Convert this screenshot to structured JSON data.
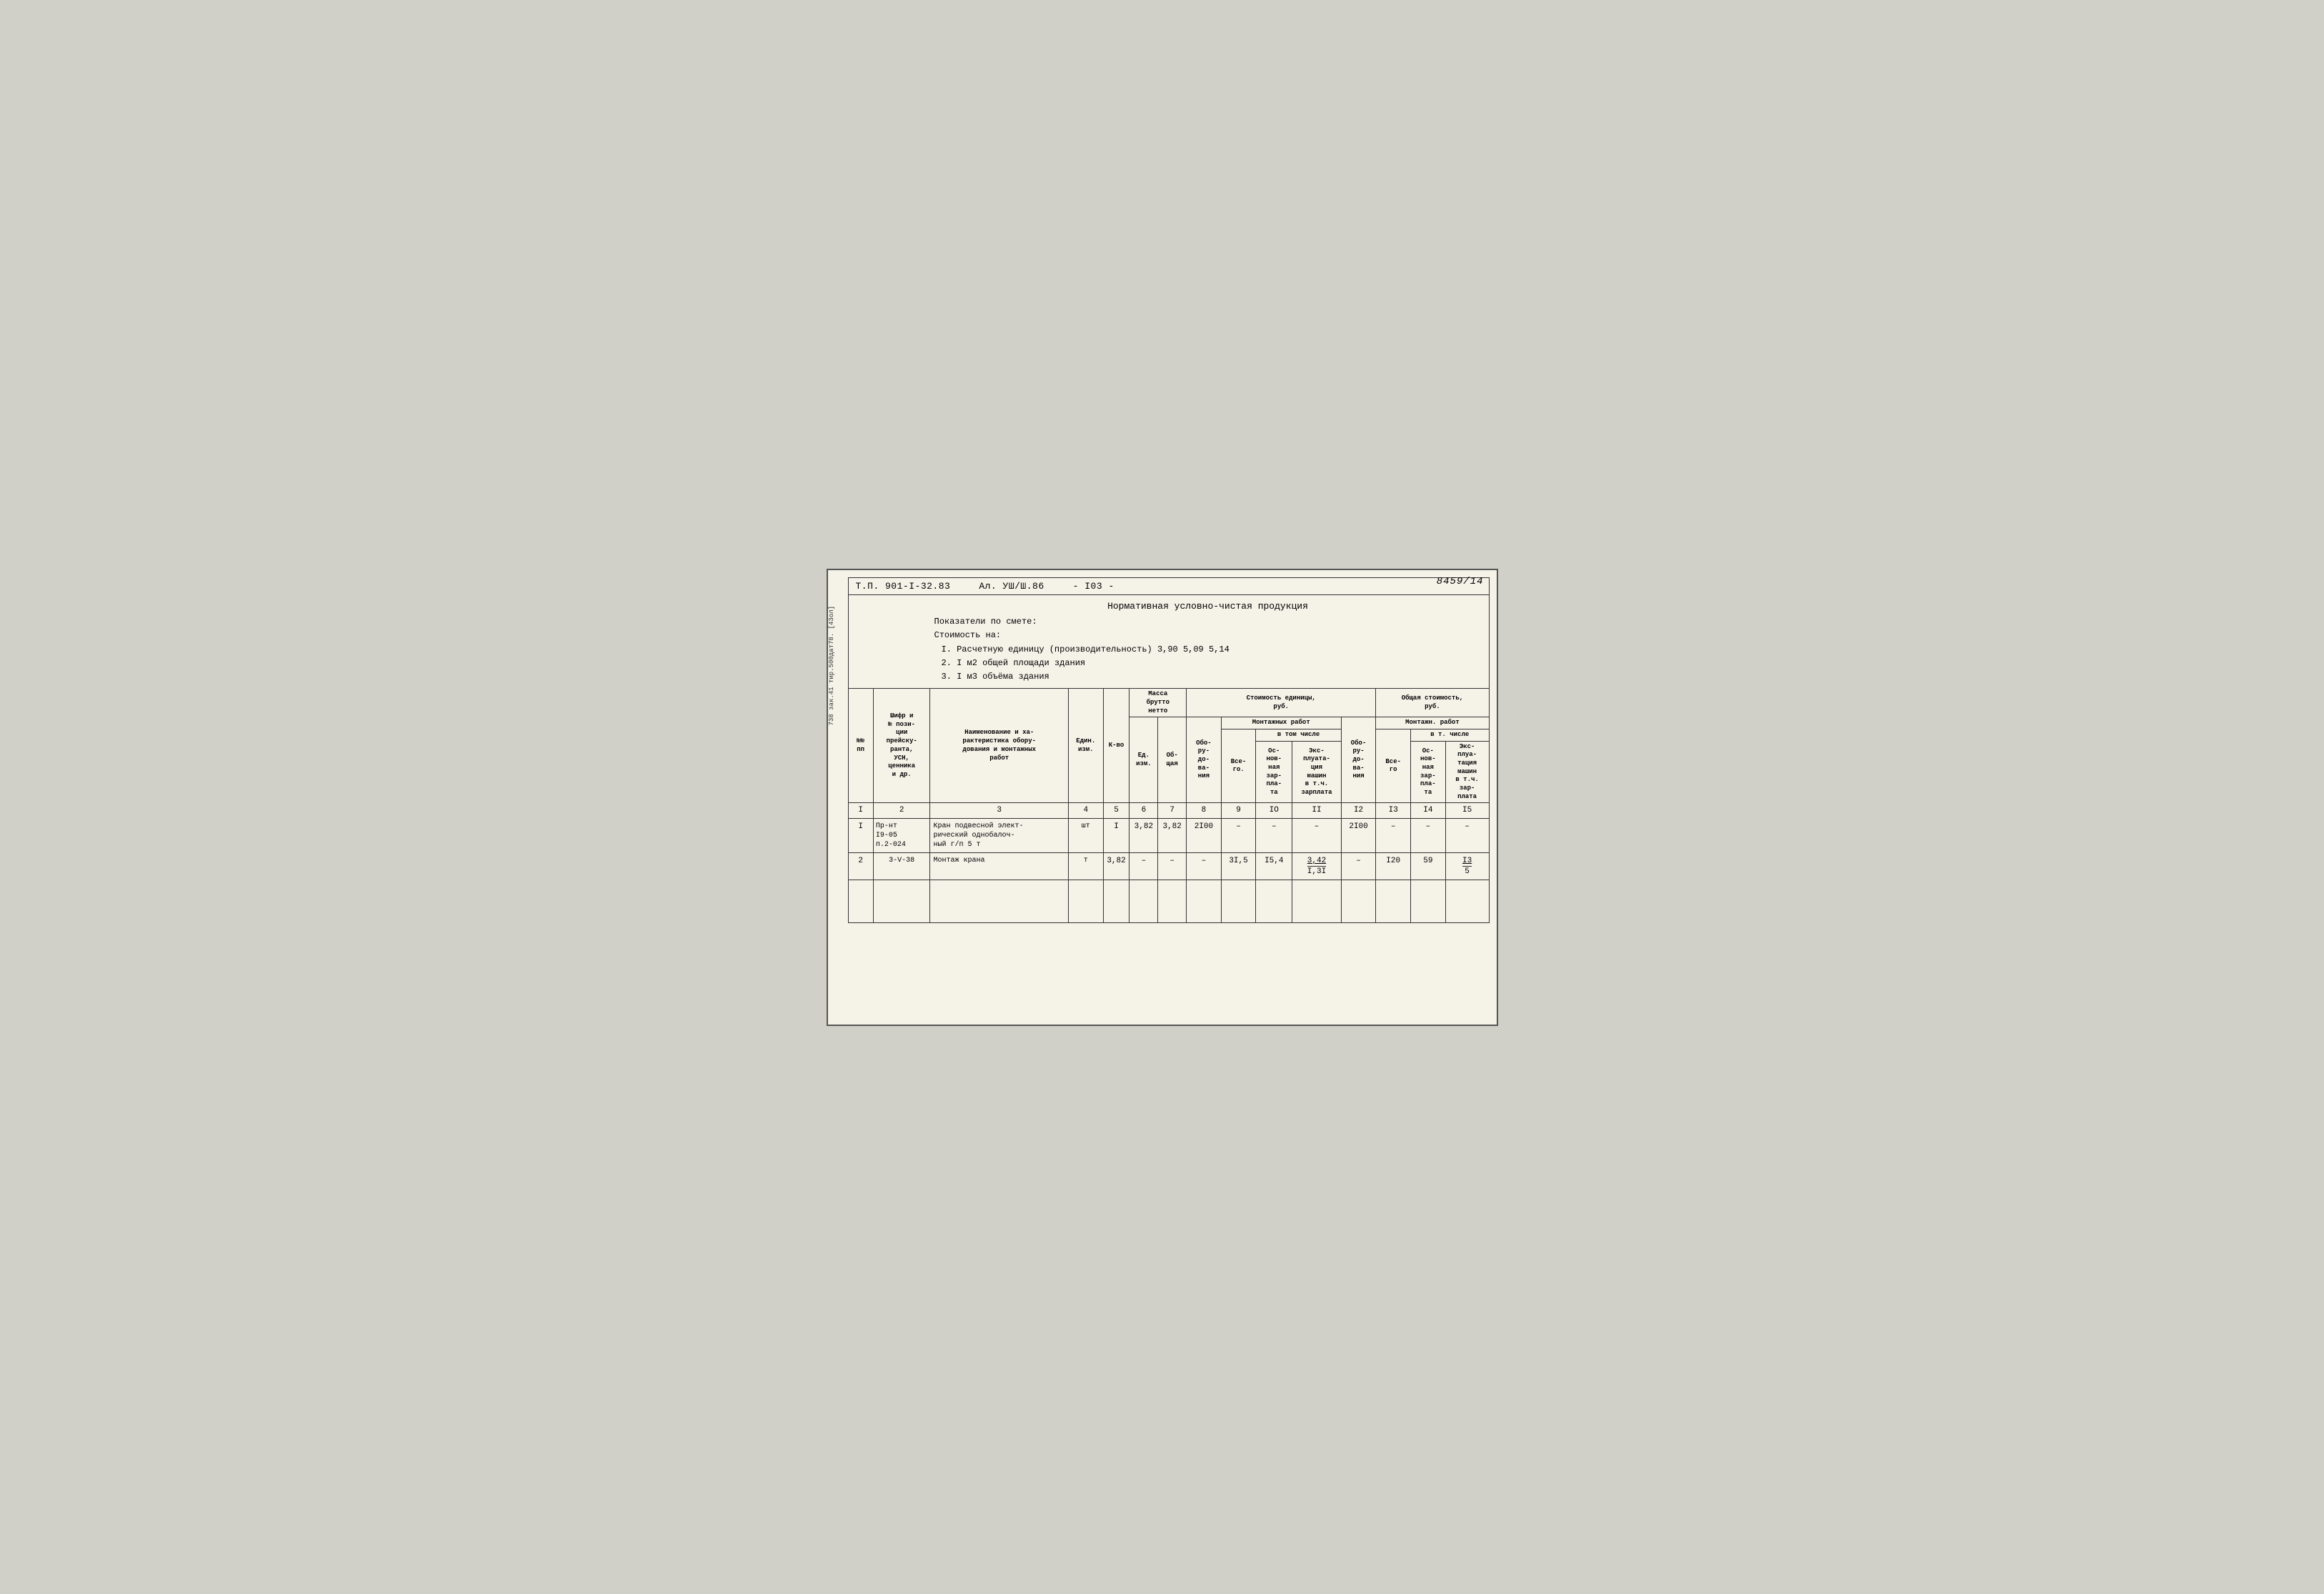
{
  "page": {
    "page_number": "8459/14",
    "side_text": "738 зак.41 тир.500дат78. [43ол]",
    "header": {
      "tp": "Т.П. 901-I-32.83",
      "al": "Ал. УШ/Ш.86",
      "num": "- I03 -"
    },
    "info": {
      "title": "Нормативная условно-чистая продукция",
      "subtitle": "Показатели по смете:",
      "cost_label": "Стоимость на:",
      "items": [
        "I. Расчетную единицу (производительность)  3,90     5,09     5,14",
        "2. I м2 общей площади здания",
        "3. I м3 объёма здания"
      ]
    },
    "table": {
      "col_headers": {
        "nn": "№№ пп",
        "shifr": "Шифр и № пози-ции прейску-ранта, УСН, ценника и др.",
        "naim": "Наименование и характеристика обору-дования и монтажных работ",
        "ed_izm": "Един. изм.",
        "kvo": "К-во",
        "massa_brutto": "Масса брутто нетто",
        "massa_ed": "Ед. изм.",
        "massa_obsh": "Об-щая",
        "steim_obo": "Обо-ру-до-ва-ния",
        "steim_mont_vsego": "Все-го.",
        "steim_mont_osnov": "Ос-нов-ная зар-пла-та",
        "steim_mont_eksp": "Экс-плуата-ция машин в т.ч. зарплата",
        "obst_obo": "Обо-ру-до-ва-ния",
        "obst_mont_vsego": "Все-го",
        "obst_mont_osnov": "Ос-нов-ная зар-пла-та",
        "obst_mont_eksp": "Экс-плуа-тация машин в т.ч. зар-плата"
      },
      "group_headers": {
        "massa": "Масса брутто нетто",
        "steim": "Стоимость единицы, руб.",
        "steim_mont": "Монтажных работ",
        "steim_vtomchisle": "в том числе",
        "obst": "Общая стоимость, руб.",
        "obst_mont": "Монтаж. работ",
        "obst_vtomchisle": "в т. числе"
      },
      "row_indices": [
        "I",
        "2",
        "3",
        "4",
        "5",
        "6",
        "7",
        "8",
        "9",
        "IO",
        "II",
        "I2",
        "I3",
        "I4",
        "I5"
      ],
      "data_rows": [
        {
          "nn": "I",
          "shifr": "Пр-нт\nI9-05\nп.2-024",
          "naim": "Кран подвесной элект-рический однобалоч-ный г/п 5 т",
          "ed": "шт",
          "kvo": "I",
          "massa_ed": "3,82",
          "massa_ob": "3,82",
          "obo": "2I00",
          "mont_vsego": "–",
          "mont_osnov": "–",
          "mont_eksp": "–",
          "obst_obo": "2I00",
          "obst_vsego": "–",
          "obst_osnov": "–",
          "obst_eksp": "–"
        },
        {
          "nn": "2",
          "shifr": "3-V-38",
          "naim": "Монтаж крана",
          "ed": "т",
          "kvo": "3,82",
          "massa_ed": "–",
          "massa_ob": "–",
          "obo": "–",
          "mont_vsego": "3I,5",
          "mont_osnov": "I5,4",
          "mont_eksp": "3,42\nI,3I",
          "obst_obo": "–",
          "obst_vsego": "I20",
          "obst_osnov": "59",
          "obst_eksp": "I3\n5"
        }
      ]
    }
  }
}
